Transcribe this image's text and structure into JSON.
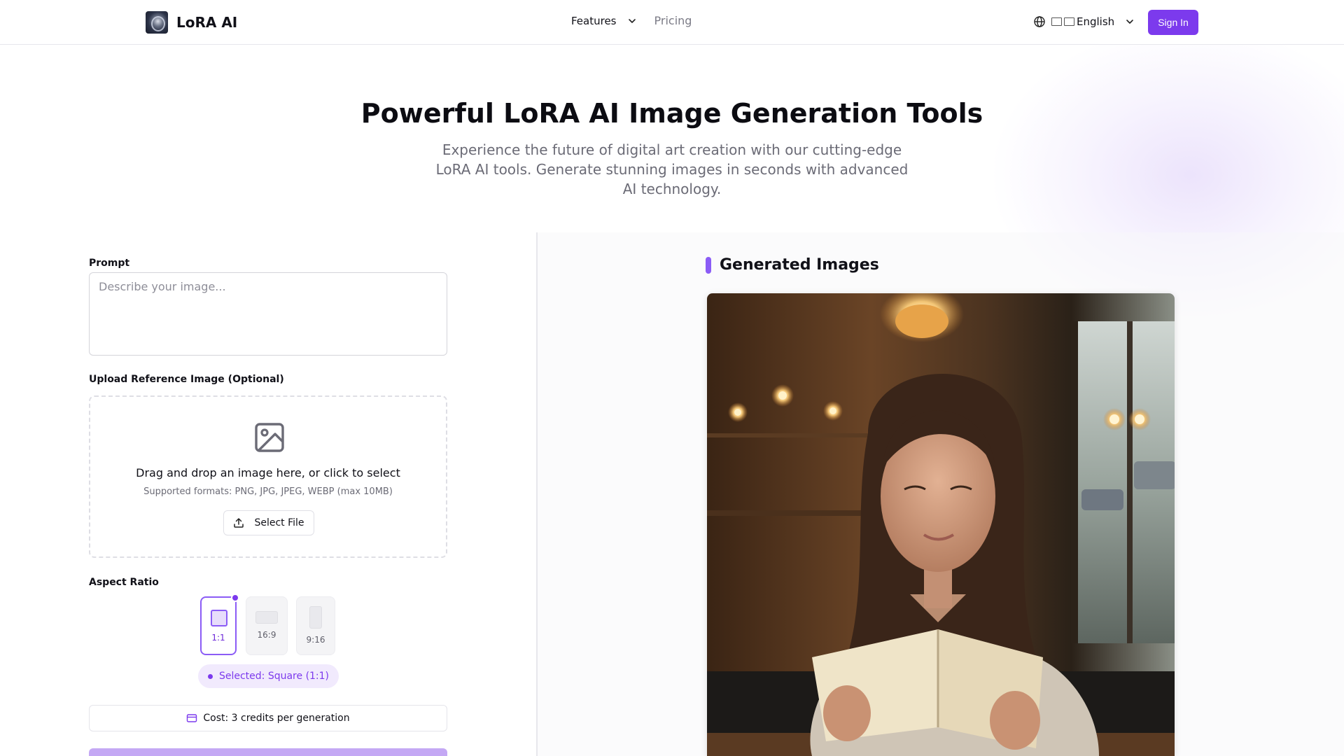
{
  "header": {
    "brand_name": "LoRA AI",
    "nav": {
      "features_label": "Features",
      "pricing_label": "Pricing"
    },
    "language_label": "English",
    "signin_label": "Sign In"
  },
  "hero": {
    "title": "Powerful LoRA AI Image Generation Tools",
    "subtitle": "Experience the future of digital art creation with our cutting-edge LoRA AI tools. Generate stunning images in seconds with advanced AI technology."
  },
  "form": {
    "prompt_label": "Prompt",
    "prompt_placeholder": "Describe your image...",
    "prompt_value": "",
    "upload_label": "Upload Reference Image (Optional)",
    "upload_title": "Drag and drop an image here, or click to select",
    "upload_hint": "Supported formats: PNG, JPG, JPEG, WEBP (max 10MB)",
    "select_file_label": "Select File",
    "aspect_label": "Aspect Ratio",
    "ratios": [
      {
        "label": "1:1",
        "selected": true
      },
      {
        "label": "16:9",
        "selected": false
      },
      {
        "label": "9:16",
        "selected": false
      }
    ],
    "selected_text": "Selected: Square (1:1)",
    "cost_text": "Cost: 3 credits per generation"
  },
  "results": {
    "title": "Generated Images"
  },
  "colors": {
    "accent": "#7c3aed",
    "accent_light": "#8b5cf6",
    "badge_bg": "#f1eafd"
  },
  "icons": [
    "globe-icon",
    "chevron-down-icon",
    "image-icon",
    "upload-icon",
    "credit-card-icon"
  ]
}
